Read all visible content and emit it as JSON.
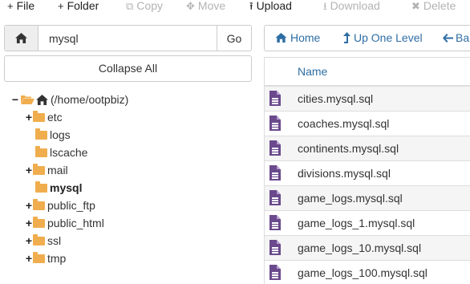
{
  "toolbar": {
    "items": [
      {
        "label": "File",
        "glyph": "+",
        "enabled": true
      },
      {
        "label": "Folder",
        "glyph": "+",
        "enabled": true
      },
      {
        "label": "Copy",
        "glyph": "⧉",
        "enabled": false
      },
      {
        "label": "Move",
        "glyph": "✥",
        "enabled": false
      },
      {
        "label": "Upload",
        "glyph": "⭱",
        "enabled": true
      },
      {
        "label": "Download",
        "glyph": "⭳",
        "enabled": false
      },
      {
        "label": "Delete",
        "glyph": "✖",
        "enabled": false
      }
    ]
  },
  "search": {
    "value": "mysql",
    "go_label": "Go"
  },
  "collapse_label": "Collapse All",
  "tree": {
    "root_label": "(/home/ootpbiz)",
    "items": [
      {
        "label": "etc",
        "expandable": true,
        "selected": false
      },
      {
        "label": "logs",
        "expandable": false,
        "selected": false
      },
      {
        "label": "lscache",
        "expandable": false,
        "selected": false
      },
      {
        "label": "mail",
        "expandable": true,
        "selected": false
      },
      {
        "label": "mysql",
        "expandable": false,
        "selected": true
      },
      {
        "label": "public_ftp",
        "expandable": true,
        "selected": false
      },
      {
        "label": "public_html",
        "expandable": true,
        "selected": false
      },
      {
        "label": "ssl",
        "expandable": true,
        "selected": false
      },
      {
        "label": "tmp",
        "expandable": true,
        "selected": false
      }
    ]
  },
  "nav": {
    "home": "Home",
    "up": "Up One Level",
    "back": "Ba"
  },
  "table": {
    "name_header": "Name",
    "files": [
      "cities.mysql.sql",
      "coaches.mysql.sql",
      "continents.mysql.sql",
      "divisions.mysql.sql",
      "game_logs.mysql.sql",
      "game_logs_1.mysql.sql",
      "game_logs_10.mysql.sql",
      "game_logs_100.mysql.sql"
    ]
  },
  "colors": {
    "link": "#2e6da4",
    "folder": "#f0ad4e",
    "file_icon": "#6a4a8c",
    "disabled": "#b3b3b3"
  }
}
